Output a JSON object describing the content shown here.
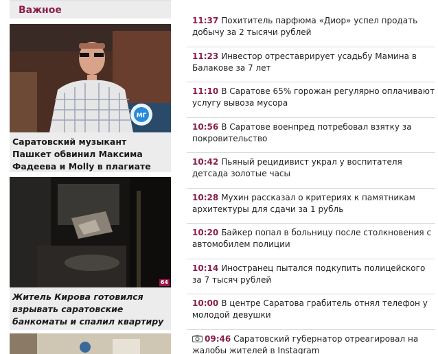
{
  "section": {
    "title": "Важное"
  },
  "featured": [
    {
      "caption": "Саратовский музыкант Пашкет обвинил Максима Фадеева и Molly в плагиате"
    },
    {
      "caption": "Житель Кирова готовился взрывать саратовские банкоматы и спалил квартиру",
      "badge": "64"
    },
    {
      "caption": ""
    }
  ],
  "news": [
    {
      "time": "11:37",
      "title": "Похититель парфюма «Диор» успел продать добычу за 2 тысячи рублей"
    },
    {
      "time": "11:23",
      "title": "Инвестор отреставрирует усадьбу Мамина в Балакове за 7 лет"
    },
    {
      "time": "11:10",
      "title": "В Саратове 65% горожан регулярно оплачивают услугу вывоза мусора"
    },
    {
      "time": "10:56",
      "title": "В Саратове военпред потребовал взятку за покровительство"
    },
    {
      "time": "10:42",
      "title": "Пьяный рецидивист украл у воспитателя детсада золотые часы"
    },
    {
      "time": "10:28",
      "title": "Мухин рассказал о критериях к памятникам архитектуры для сдачи за 1 рубль"
    },
    {
      "time": "10:20",
      "title": "Байкер попал в больницу после столкновения с автомобилем полиции"
    },
    {
      "time": "10:14",
      "title": "Иностранец пытался подкупить полицейского за 7 тысяч рублей"
    },
    {
      "time": "10:00",
      "title": "В центре Саратова грабитель отнял телефон у молодой девушки"
    },
    {
      "time": "09:46",
      "title": "Саратовский губернатор отреагировал на жалобы жителей в Instagram",
      "icon": "camera-icon"
    }
  ],
  "colors": {
    "accent": "#8b1d4a",
    "header_bg": "#ececec",
    "badge": "#a0124a"
  }
}
